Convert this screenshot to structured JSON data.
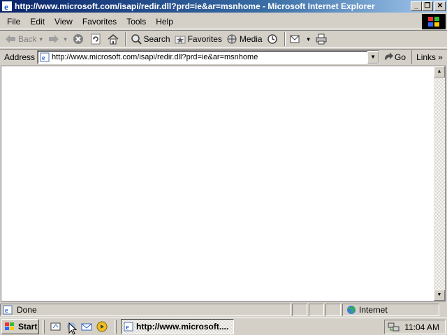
{
  "window": {
    "title": "http://www.microsoft.com/isapi/redir.dll?prd=ie&ar=msnhome - Microsoft Internet Explorer",
    "minimize_label": "_",
    "restore_label": "❐",
    "close_label": "✕"
  },
  "menu": [
    "File",
    "Edit",
    "View",
    "Favorites",
    "Tools",
    "Help"
  ],
  "toolbar": {
    "back_label": "Back",
    "search_label": "Search",
    "favorites_label": "Favorites",
    "media_label": "Media"
  },
  "address": {
    "label": "Address",
    "url": "http://www.microsoft.com/isapi/redir.dll?prd=ie&ar=msnhome",
    "go_label": "Go",
    "links_label": "Links",
    "links_chevron": "»"
  },
  "status": {
    "text": "Done",
    "zone": "Internet"
  },
  "taskbar": {
    "start_label": "Start",
    "task_label": "http://www.microsoft....",
    "clock": "11:04 AM"
  },
  "colors": {
    "titlebar_start": "#0a246a",
    "titlebar_end": "#a6caf0",
    "chrome": "#d4d0c8"
  }
}
